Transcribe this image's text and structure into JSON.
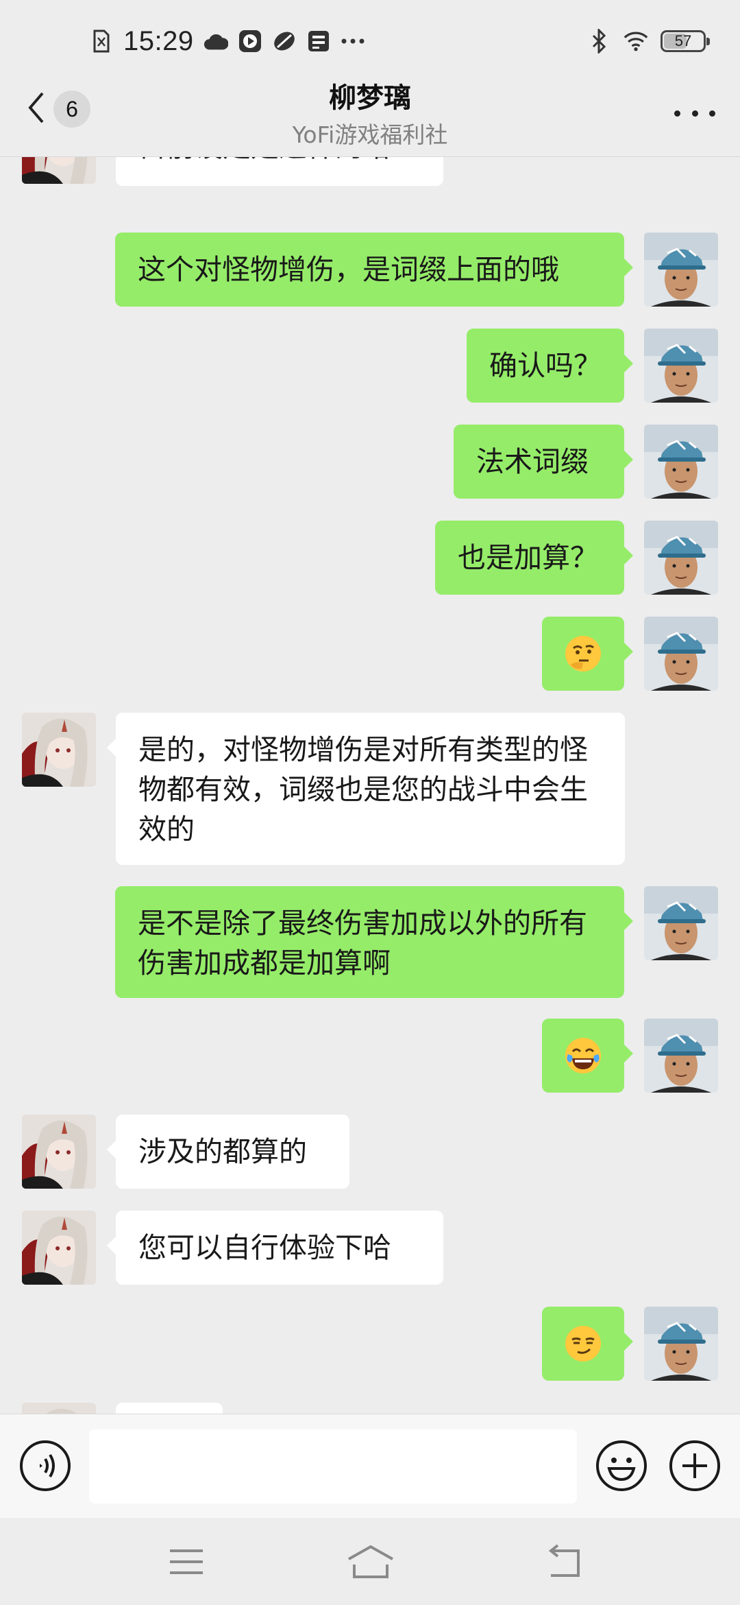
{
  "status_bar": {
    "time": "15:29",
    "battery": "57",
    "icons": [
      "sim-icon",
      "cloud-icon",
      "play-icon",
      "leaf-icon",
      "card-icon",
      "more-dots-icon",
      "bluetooth-icon",
      "wifi-icon",
      "battery-icon"
    ]
  },
  "header": {
    "unread_count": "6",
    "title": "柳梦璃",
    "subtitle": "YoFi游戏福利社"
  },
  "messages": [
    {
      "side": "in",
      "text": "目前设定是这样的哈"
    },
    {
      "side": "out",
      "text": "这个对怪物增伤，是词缀上面的哦"
    },
    {
      "side": "out",
      "text": "确认吗？"
    },
    {
      "side": "out",
      "text": "法术词缀"
    },
    {
      "side": "out",
      "text": "也是加算？"
    },
    {
      "side": "out",
      "emoji": "thinking-face-emoji"
    },
    {
      "side": "in",
      "text": "是的，对怪物增伤是对所有类型的怪物都有效，词缀也是您的战斗中会生效的"
    },
    {
      "side": "out",
      "text": "是不是除了最终伤害加成以外的所有伤害加成都是加算啊"
    },
    {
      "side": "out",
      "emoji": "tears-of-joy-emoji"
    },
    {
      "side": "in",
      "text": "涉及的都算的"
    },
    {
      "side": "in",
      "text": "您可以自行体验下哈"
    },
    {
      "side": "out",
      "emoji": "smirk-emoji"
    }
  ],
  "input_bar": {
    "icons": [
      "voice-icon",
      "emoji-icon",
      "plus-icon"
    ]
  },
  "nav_bar": {
    "icons": [
      "menu-icon",
      "home-icon",
      "back-nav-icon"
    ]
  }
}
